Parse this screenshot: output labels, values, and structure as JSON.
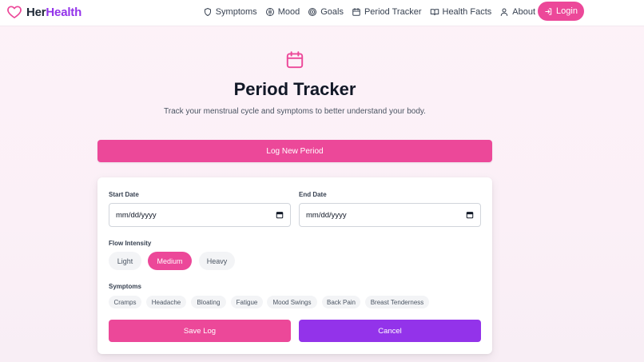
{
  "brand": {
    "prefix": "Her",
    "suffix": "Health"
  },
  "nav": {
    "items": [
      {
        "label": "Symptoms",
        "icon": "shield-icon"
      },
      {
        "label": "Mood",
        "icon": "brain-icon"
      },
      {
        "label": "Goals",
        "icon": "target-icon"
      },
      {
        "label": "Period Tracker",
        "icon": "calendar-icon"
      },
      {
        "label": "Health Facts",
        "icon": "book-icon"
      },
      {
        "label": "About",
        "icon": "user-icon"
      }
    ],
    "login_label": "Login"
  },
  "hero": {
    "icon": "calendar-icon",
    "title": "Period Tracker",
    "subtitle": "Track your menstrual cycle and symptoms to better understand your body."
  },
  "log_new_label": "Log New Period",
  "form": {
    "start_date": {
      "label": "Start Date",
      "value": "mm/dd/yyyy"
    },
    "end_date": {
      "label": "End Date",
      "value": "mm/dd/yyyy"
    },
    "flow": {
      "label": "Flow Intensity",
      "options": [
        "Light",
        "Medium",
        "Heavy"
      ],
      "selected": "Medium"
    },
    "symptoms": {
      "label": "Symptoms",
      "options": [
        "Cramps",
        "Headache",
        "Bloating",
        "Fatigue",
        "Mood Swings",
        "Back Pain",
        "Breast Tenderness"
      ]
    },
    "save_label": "Save Log",
    "cancel_label": "Cancel"
  },
  "colors": {
    "accent_pink": "#ec4899",
    "accent_purple": "#9333ea",
    "background": "#fdf2f8"
  }
}
